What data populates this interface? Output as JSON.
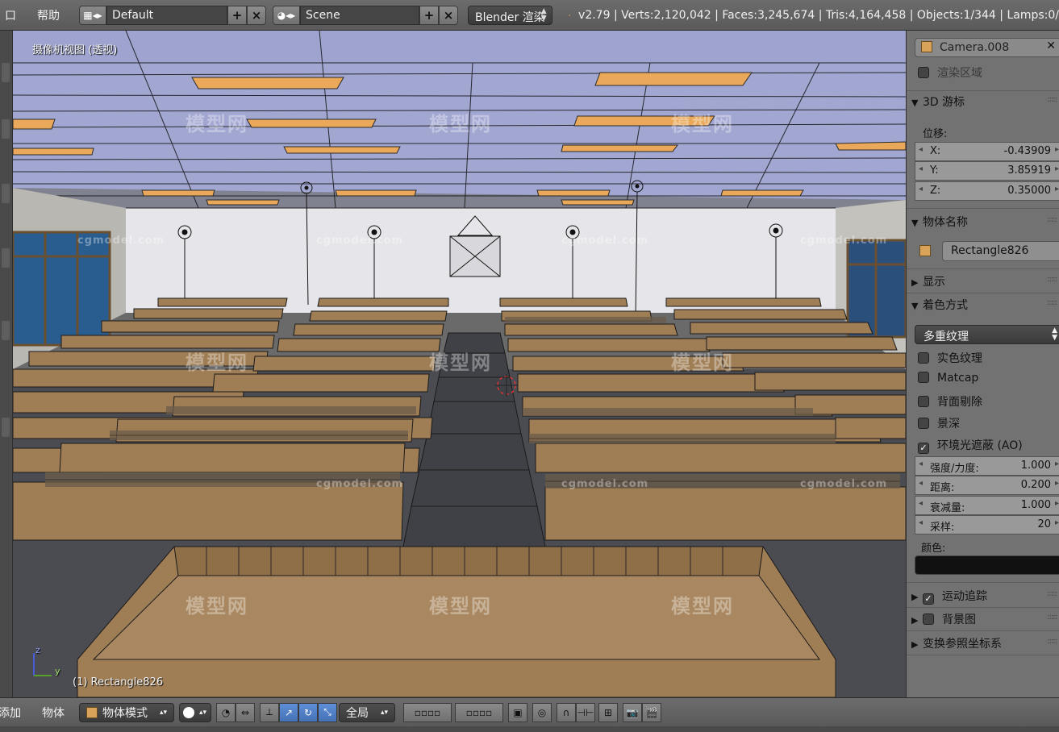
{
  "top_header": {
    "menu_partial": "口",
    "menu_help": "帮助",
    "layout_name": "Default",
    "scene_name": "Scene",
    "render_engine": "Blender 渲染",
    "stats": "v2.79 | Verts:2,120,042 | Faces:3,245,674 | Tris:4,164,458 | Objects:1/344 | Lamps:0/"
  },
  "viewport": {
    "view_label": "摄像机视图 (透视)",
    "object_label": "(1) Rectangle826",
    "axis_z": "z",
    "axis_y": "y"
  },
  "watermarks": {
    "logo_text": "模型网",
    "site_text": "cgmodel.com"
  },
  "properties": {
    "camera_name": "Camera.008",
    "render_region": "渲染区域",
    "cursor_header": "3D 游标",
    "location_label": "位移:",
    "cursor_x_label": "X:",
    "cursor_x": "-0.43909",
    "cursor_y_label": "Y:",
    "cursor_y": "3.85919",
    "cursor_z_label": "Z:",
    "cursor_z": "0.35000",
    "item_header": "物体名称",
    "item_name": "Rectangle826",
    "display_header": "显示",
    "shading_header": "着色方式",
    "shading_mode": "多重纹理",
    "solid_texture": "实色纹理",
    "matcap": "Matcap",
    "backface_culling": "背面剔除",
    "depth_of_field": "景深",
    "ambient_occlusion": "环境光遮蔽 (AO)",
    "ao_strength_label": "强度/力度:",
    "ao_strength": "1.000",
    "ao_distance_label": "距离:",
    "ao_distance": "0.200",
    "ao_falloff_label": "衰减量:",
    "ao_falloff": "1.000",
    "ao_samples_label": "采样:",
    "ao_samples": "20",
    "color_label": "颜色:",
    "motion_tracking": "运动追踪",
    "background_images": "背景图",
    "transform_orientations": "变换参照坐标系"
  },
  "bottom_header": {
    "menu_add_partial": "添加",
    "menu_object": "物体",
    "mode": "物体模式",
    "pivot_global": "全局"
  },
  "colors": {
    "ceiling": "#9ea4cf",
    "wall": "#e6e6ea",
    "desk": "#a07e55",
    "floor": "#4a4c52",
    "light_panel": "#e9a85a",
    "active_blue": "#5680c2"
  }
}
